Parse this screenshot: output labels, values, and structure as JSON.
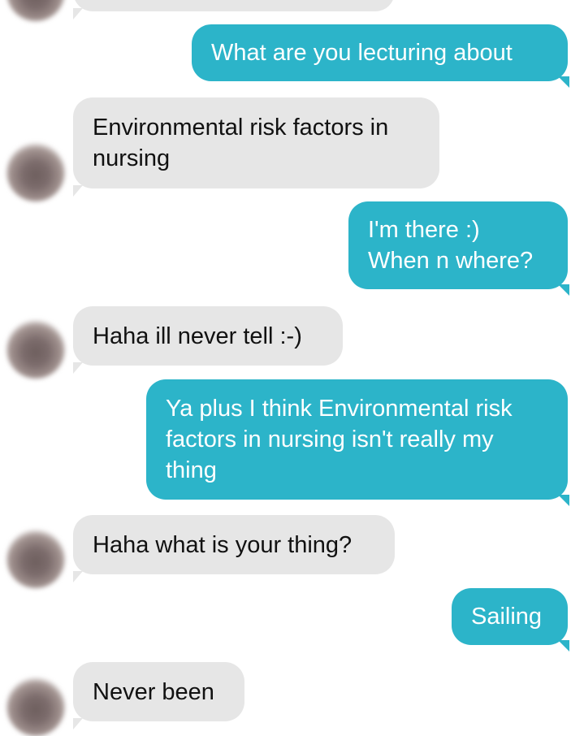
{
  "colors": {
    "outgoing_bubble": "#2cb4c9",
    "incoming_bubble": "#e6e6e6",
    "outgoing_text": "#ffffff",
    "incoming_text": "#111111"
  },
  "messages": [
    {
      "direction": "outgoing",
      "text": "What are you lecturing about"
    },
    {
      "direction": "incoming",
      "text": "Environmental risk factors in\nnursing"
    },
    {
      "direction": "outgoing",
      "text": "I'm there :)\nWhen n where?"
    },
    {
      "direction": "incoming",
      "text": "Haha ill never tell :-)"
    },
    {
      "direction": "outgoing",
      "text": "Ya plus I think Environmental risk\nfactors in nursing isn't really my\nthing"
    },
    {
      "direction": "incoming",
      "text": "Haha what is your thing?"
    },
    {
      "direction": "outgoing",
      "text": "Sailing"
    },
    {
      "direction": "incoming",
      "text": "Never been"
    }
  ],
  "avatar_icon": "contact-avatar-icon"
}
